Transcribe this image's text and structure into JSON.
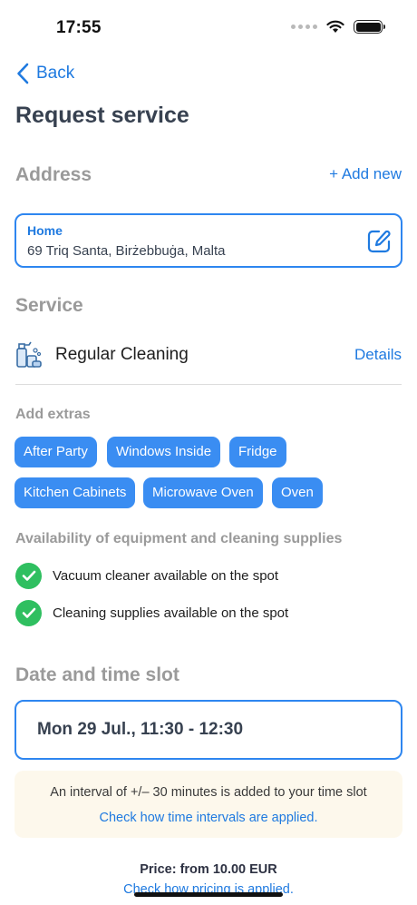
{
  "status": {
    "time": "17:55"
  },
  "nav": {
    "back_label": "Back"
  },
  "page": {
    "title": "Request service"
  },
  "address": {
    "section_title": "Address",
    "add_new_label": "+ Add new",
    "card": {
      "label": "Home",
      "text": "69 Triq Santa, Birżebbuġa, Malta"
    }
  },
  "service": {
    "section_title": "Service",
    "name": "Regular Cleaning",
    "details_label": "Details"
  },
  "extras": {
    "title": "Add extras",
    "items": [
      "After Party",
      "Windows Inside",
      "Fridge",
      "Kitchen Cabinets",
      "Microwave Oven",
      "Oven"
    ]
  },
  "availability": {
    "title": "Availability of equipment and cleaning supplies",
    "items": [
      "Vacuum cleaner available on the spot",
      "Cleaning supplies available on the spot"
    ]
  },
  "slot": {
    "section_title": "Date and time slot",
    "value": "Mon 29 Jul., 11:30 - 12:30"
  },
  "info": {
    "text": "An interval of +/– 30 minutes is added to your time slot",
    "link": "Check how time intervals are applied."
  },
  "price": {
    "text": "Price: from 10.00 EUR",
    "link": "Check how pricing is applied."
  },
  "colors": {
    "accent": "#1f7ae0",
    "chip": "#3a8df2",
    "success": "#2fbf60",
    "info_bg": "#fdf8ec"
  }
}
